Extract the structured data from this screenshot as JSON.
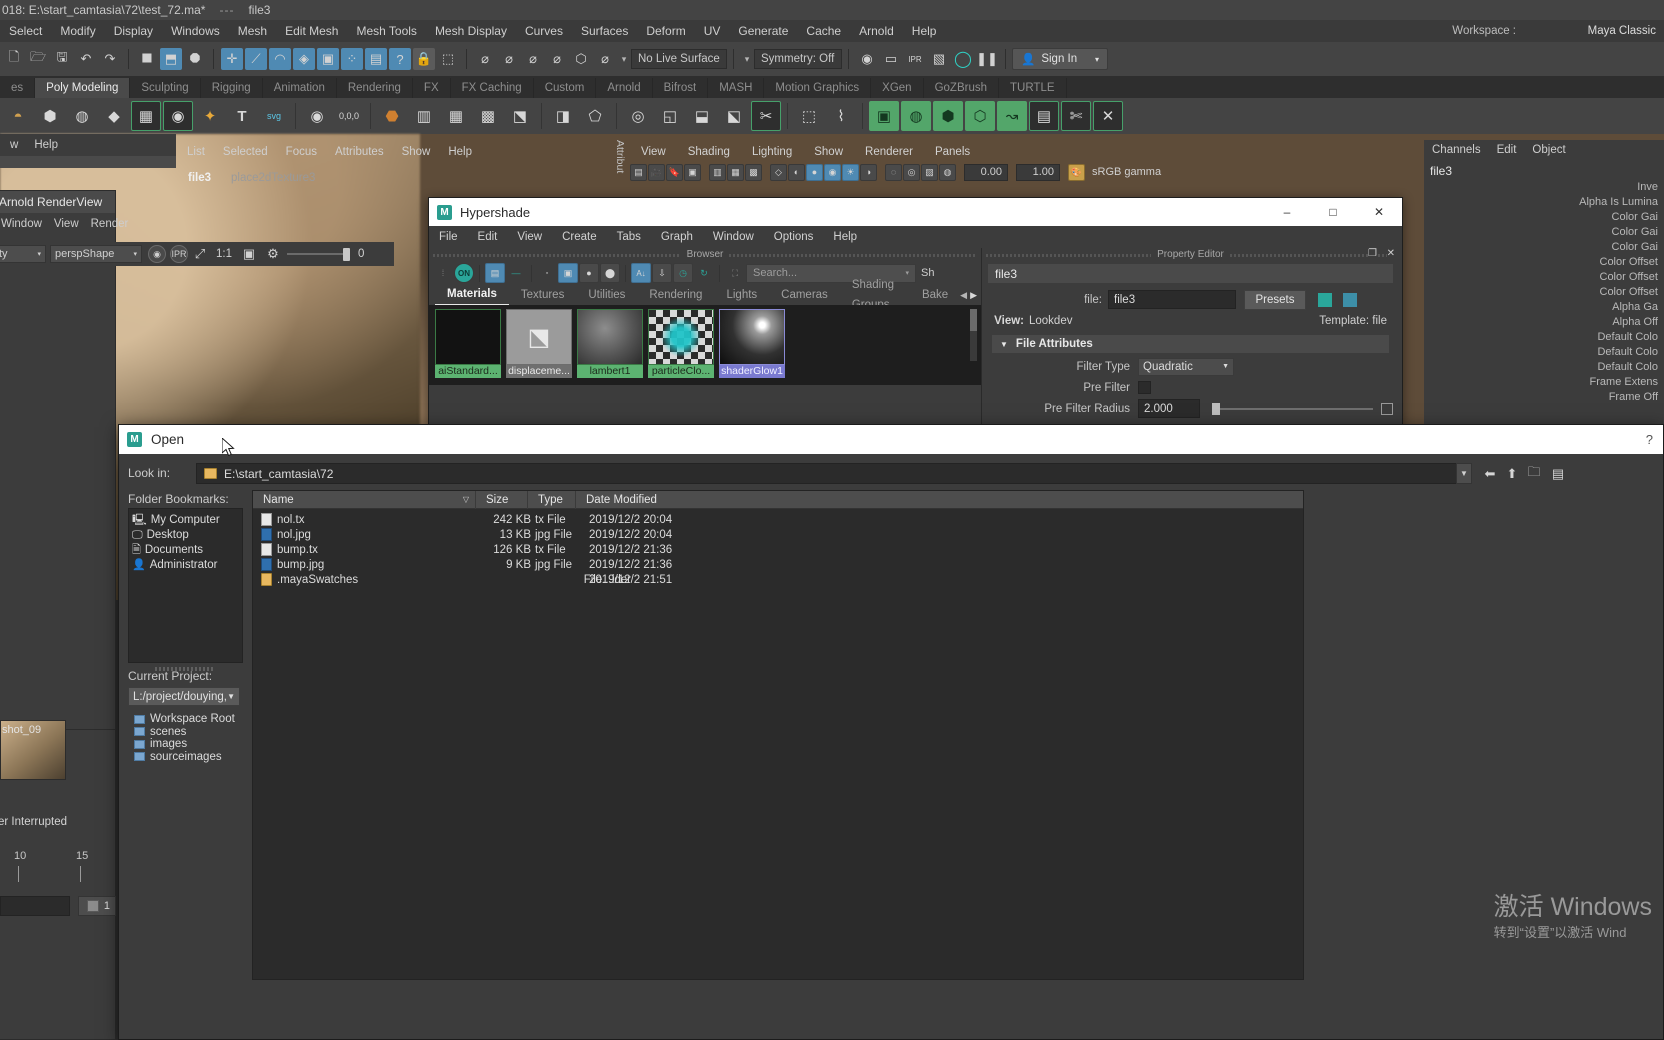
{
  "titlebar": {
    "project": "018: E:\\start_camtasia\\72\\test_72.ma*",
    "separator": "---",
    "node": "file3"
  },
  "menubar": {
    "items": [
      "Select",
      "Modify",
      "Display",
      "Windows",
      "Mesh",
      "Edit Mesh",
      "Mesh Tools",
      "Mesh Display",
      "Curves",
      "Surfaces",
      "Deform",
      "UV",
      "Generate",
      "Cache",
      "Arnold",
      "Help"
    ],
    "workspace_label": "Workspace :",
    "workspace_value": "Maya Classic"
  },
  "statusbar": {
    "live_surface": "No Live Surface",
    "symmetry": "Symmetry: Off",
    "signin": "Sign In"
  },
  "shelf_tabs": {
    "items": [
      "es",
      "Poly Modeling",
      "Sculpting",
      "Rigging",
      "Animation",
      "Rendering",
      "FX",
      "FX Caching",
      "Custom",
      "Arnold",
      "Bifrost",
      "MASH",
      "Motion Graphics",
      "XGen",
      "GoZBrush",
      "TURTLE"
    ],
    "active": "Poly Modeling"
  },
  "arnold_render_view": {
    "title": "Arnold RenderView",
    "menu": [
      "Window",
      "View",
      "Render"
    ],
    "camera": "perspShape",
    "ratio": "1:1",
    "value": "0",
    "combo_left": "ty"
  },
  "left_panel": {
    "menu": [
      "w",
      "Help"
    ]
  },
  "attribute_editor": {
    "menu": [
      "List",
      "Selected",
      "Focus",
      "Attributes",
      "Show",
      "Help"
    ],
    "tabs": [
      "file3",
      "place2dTexture3"
    ],
    "active_tab": "file3",
    "vertical_label": "Attribut"
  },
  "viewport_panel": {
    "menu": [
      "View",
      "Shading",
      "Lighting",
      "Show",
      "Renderer",
      "Panels"
    ],
    "exposure": "0.00",
    "gamma": "1.00",
    "colorspace": "sRGB gamma"
  },
  "right_dock": {
    "menu": [
      "Channels",
      "Edit",
      "Object"
    ],
    "node": "file3",
    "attributes": [
      "Inve",
      "Alpha Is Lumina",
      "Color Gai",
      "Color Gai",
      "Color Gai",
      "Color Offset",
      "Color Offset",
      "Color Offset",
      "Alpha Ga",
      "Alpha Off",
      "Default Colo",
      "Default Colo",
      "Default Colo",
      "Frame Extens",
      "Frame Off"
    ]
  },
  "hypershade": {
    "title": "Hypershade",
    "window_buttons": [
      "–",
      "□",
      "✕"
    ],
    "menu": [
      "File",
      "Edit",
      "View",
      "Create",
      "Tabs",
      "Graph",
      "Window",
      "Options",
      "Help"
    ],
    "browser_label": "Browser",
    "search_placeholder": "Search...",
    "show_label": "Sh",
    "toolbar_on_label": "ON",
    "tabs": [
      "Materials",
      "Textures",
      "Utilities",
      "Rendering",
      "Lights",
      "Cameras",
      "Shading Groups",
      "Bake"
    ],
    "active_tab": "Materials",
    "swatches": [
      {
        "label": "aiStandard...",
        "kind": "dark",
        "selected": false
      },
      {
        "label": "displaceme...",
        "kind": "grey",
        "selected": false
      },
      {
        "label": "lambert1",
        "kind": "sphere",
        "selected": false
      },
      {
        "label": "particleClo...",
        "kind": "checker",
        "selected": false
      },
      {
        "label": "shaderGlow1",
        "kind": "glow",
        "selected": true
      }
    ],
    "property_editor": {
      "panel_label": "Property Editor",
      "node_name": "file3",
      "file_label": "file:",
      "file_value": "file3",
      "presets_button": "Presets",
      "view_label": "View:",
      "view_value": "Lookdev",
      "template_text": "Template: file",
      "section_title": "File Attributes",
      "filter_type_label": "Filter Type",
      "filter_type_value": "Quadratic",
      "pre_filter_label": "Pre Filter",
      "pre_filter_radius_label": "Pre Filter Radius",
      "pre_filter_radius_value": "2.000"
    }
  },
  "open_dialog": {
    "title": "Open",
    "help_glyph": "?",
    "look_in_label": "Look in:",
    "look_in_value": "E:\\start_camtasia\\72",
    "bookmarks_label": "Folder Bookmarks:",
    "bookmarks": [
      {
        "label": "My Computer",
        "icon": "computer-icon"
      },
      {
        "label": "Desktop",
        "icon": "desktop-icon"
      },
      {
        "label": "Documents",
        "icon": "documents-icon"
      },
      {
        "label": "Administrator",
        "icon": "user-icon"
      }
    ],
    "current_project_label": "Current Project:",
    "current_project_value": "L:/project/douying,",
    "project_folders": [
      "Workspace Root",
      "scenes",
      "images",
      "sourceimages"
    ],
    "columns": [
      "Name",
      "Size",
      "Type",
      "Date Modified"
    ],
    "files": [
      {
        "name": "nol.tx",
        "size": "242 KB",
        "type": "tx File",
        "date": "2019/12/2 20:04",
        "icon": "doc"
      },
      {
        "name": "nol.jpg",
        "size": "13 KB",
        "type": "jpg File",
        "date": "2019/12/2 20:04",
        "icon": "img"
      },
      {
        "name": "bump.tx",
        "size": "126 KB",
        "type": "tx File",
        "date": "2019/12/2 21:36",
        "icon": "doc"
      },
      {
        "name": "bump.jpg",
        "size": "9 KB",
        "type": "jpg File",
        "date": "2019/12/2 21:36",
        "icon": "img"
      },
      {
        "name": ".mayaSwatches",
        "size": "",
        "type": "File...lder",
        "date": "2019/12/2 21:51",
        "icon": "fold"
      }
    ]
  },
  "timeline": {
    "interrupted": "er Interrupted",
    "tick_a": "10",
    "tick_b": "15",
    "frame": "1",
    "shelf_thumb_label": "shot_09"
  },
  "watermark": {
    "line1": "激活 Windows",
    "line2": "转到“设置”以激活 Wind"
  },
  "colors": {
    "accent_blue": "#4f8ab3",
    "teal": "#2aa69a",
    "swatch_green": "#5cb371",
    "swatch_selected": "#7a7ad0",
    "panel_bg": "#3c3c3c"
  }
}
